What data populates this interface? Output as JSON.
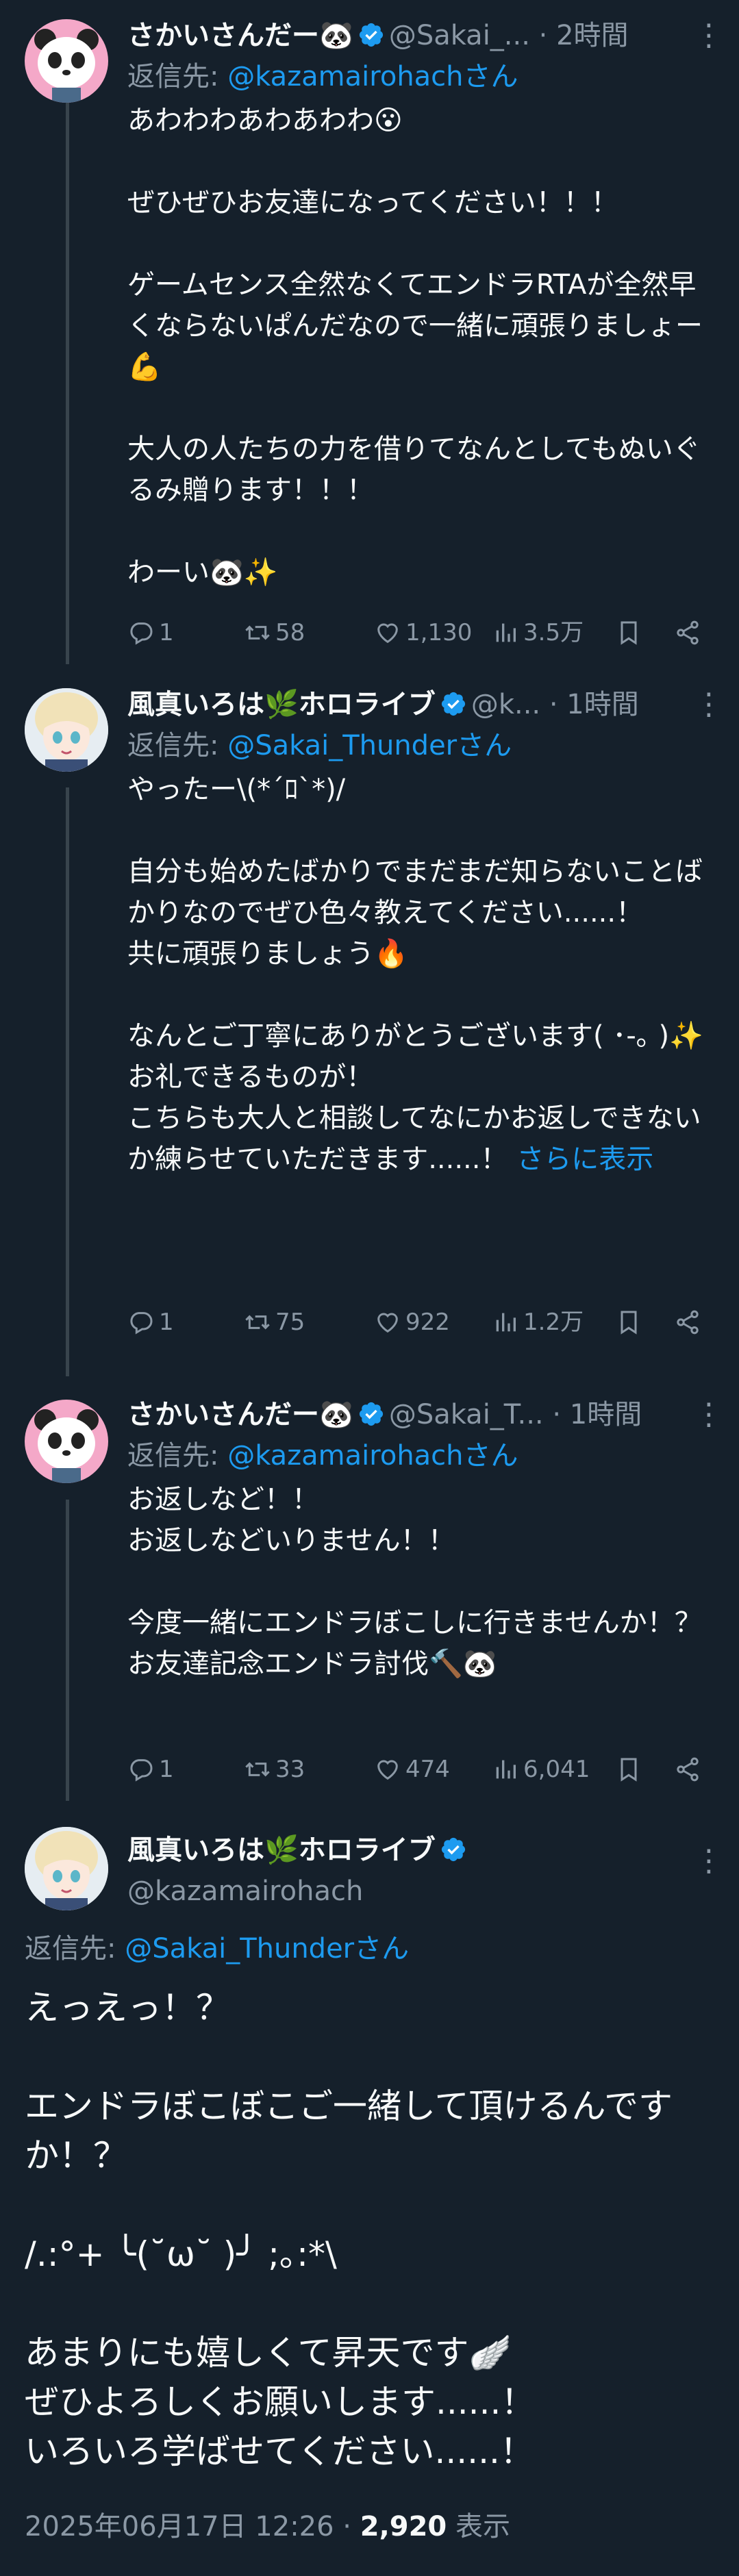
{
  "tweets": [
    {
      "name": "さかいさんだー🐼",
      "handle": "@Sakai_...",
      "time": "2時間",
      "reply_label": "返信先: ",
      "reply_handle": "@kazamairohachさん",
      "text": "あわわわあわあわわ😮\n\nぜひぜひお友達になってください！！！\n\nゲームセンス全然なくてエンドラRTAが全然早くならないぱんだなので一緒に頑張りましょー💪\n\n大人の人たちの力を借りてなんとしてもぬいぐるみ贈ります！！！\n\nわーい🐼✨",
      "replies": "1",
      "retweets": "58",
      "likes": "1,130",
      "views": "3.5万"
    },
    {
      "name": "風真いろは🌿ホロライブ",
      "handle": "@k...",
      "time": "1時間",
      "reply_label": "返信先: ",
      "reply_handle": "@Sakai_Thunderさん",
      "text": "やったー\\(*´ﾛ`*)/\n\n自分も始めたばかりでまだまだ知らないことばかりなのでぜひ色々教えてください......！\n共に頑張りましょう🔥\n\nなんとご丁寧にありがとうございます( ･-｡ )✨\nお礼できるものが！\nこちらも大人と相談してなにかお返しできないか練らせていただきます......！ ",
      "show_more": "さらに表示",
      "replies": "1",
      "retweets": "75",
      "likes": "922",
      "views": "1.2万"
    },
    {
      "name": "さかいさんだー🐼",
      "handle": "@Sakai_T...",
      "time": "1時間",
      "reply_label": "返信先: ",
      "reply_handle": "@kazamairohachさん",
      "text": "お返しなど！！\nお返しなどいりません！！\n\n今度一緒にエンドラぼこしに行きませんか！？\nお友達記念エンドラ討伐🔨🐼",
      "replies": "1",
      "retweets": "33",
      "likes": "474",
      "views": "6,041"
    }
  ],
  "main": {
    "name": "風真いろは🌿ホロライブ",
    "handle": "@kazamairohach",
    "reply_label": "返信先: ",
    "reply_handle": "@Sakai_Thunderさん",
    "text": "えっえっ！？\n\nエンドラぼこぼこご一緒して頂けるんですか！？\n\n/.:°+ ╰(˘ω˘ )╯ ;｡:*\\\n\nあまりにも嬉しくて昇天です🪽\nぜひよろしくお願いします......！\nいろいろ学ばせてください......！",
    "date": "2025年06月17日 12:26 · ",
    "views_count": "2,920",
    "views_label": " 表示"
  },
  "icons": [
    "more-icon",
    "verified-icon",
    "reply-icon",
    "retweet-icon",
    "like-icon",
    "views-icon",
    "bookmark-icon",
    "share-icon"
  ],
  "colors": {
    "background": "#15202b",
    "text": "#f7f9f9",
    "muted": "#8b98a5",
    "link": "#1d9bf0",
    "verified": "#1d9bf0"
  }
}
